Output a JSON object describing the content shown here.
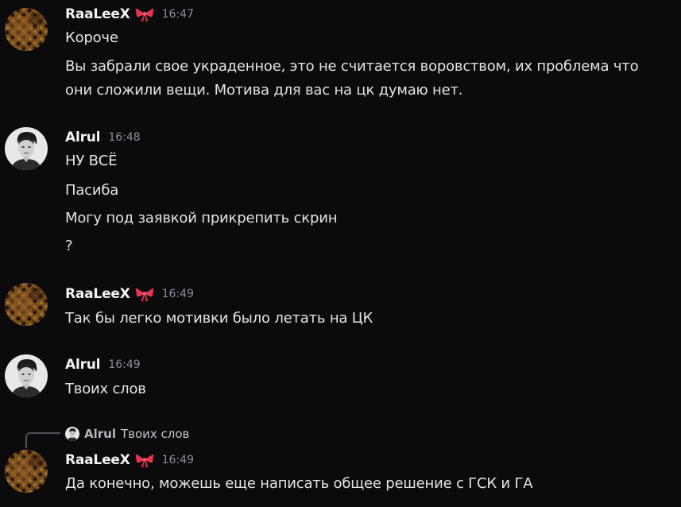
{
  "users": {
    "raaleex": "RaaLeeX",
    "alrul": "Alrul"
  },
  "icons": {
    "bow": "ribbon-bow-emoji",
    "avatar_raaleex": "leopard-avatar",
    "avatar_alrul": "portrait-avatar"
  },
  "colors": {
    "background": "#0b0a0d",
    "username": "#f2f3f5",
    "timestamp": "#8e9099",
    "text": "#e3e4e8",
    "bow": "#e5364f"
  },
  "messages": [
    {
      "author": "RaaLeeX",
      "time": "16:47",
      "lines": [
        "Короче",
        "Вы забрали свое украденное, это не считается воровством, их проблема что",
        "они сложили вещи. Мотива для вас на цк думаю нет."
      ]
    },
    {
      "author": "Alrul",
      "time": "16:48",
      "lines": [
        "НУ ВСЁ",
        "Пасиба",
        "Могу под заявкой прикрепить скрин",
        "?"
      ]
    },
    {
      "author": "RaaLeeX",
      "time": "16:49",
      "lines": [
        "Так бы легко мотивки было летать на ЦК"
      ]
    },
    {
      "author": "Alrul",
      "time": "16:49",
      "lines": [
        "Твоих слов"
      ]
    },
    {
      "author": "RaaLeeX",
      "time": "16:49",
      "reply": {
        "author": "Alrul",
        "text": "Твоих слов"
      },
      "lines": [
        "Да конечно, можешь еще написать общее решение с ГСК и ГА"
      ]
    }
  ]
}
